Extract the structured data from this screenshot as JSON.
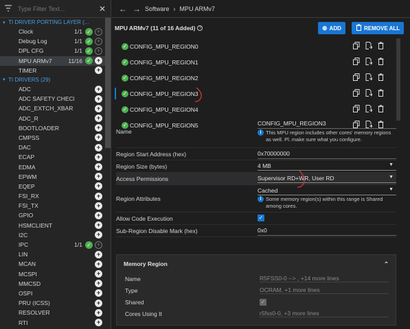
{
  "sidebar": {
    "filter_placeholder": "Type Filter Text...",
    "groups": [
      {
        "label": "TI DRIVER PORTING LAYER (...",
        "items": [
          {
            "label": "Clock",
            "count": "1/1",
            "checked": true,
            "add": "dim"
          },
          {
            "label": "Debug Log",
            "count": "1/1",
            "checked": true,
            "add": "dim"
          },
          {
            "label": "DPL CFG",
            "count": "1/1",
            "checked": true,
            "add": "dim"
          },
          {
            "label": "MPU ARMv7",
            "count": "11/16",
            "checked": true,
            "add": "solid",
            "active": true
          },
          {
            "label": "TIMER",
            "count": "",
            "checked": false,
            "add": "solid"
          }
        ]
      },
      {
        "label": "TI DRIVERS (29)",
        "items": [
          {
            "label": "ADC",
            "count": "",
            "checked": false,
            "add": "solid"
          },
          {
            "label": "ADC SAFETY CHECKER",
            "count": "",
            "checked": false,
            "add": "solid"
          },
          {
            "label": "ADC_EXTCH_XBAR",
            "count": "",
            "checked": false,
            "add": "solid"
          },
          {
            "label": "ADC_R",
            "count": "",
            "checked": false,
            "add": "solid"
          },
          {
            "label": "BOOTLOADER",
            "count": "",
            "checked": false,
            "add": "solid"
          },
          {
            "label": "CMPSS",
            "count": "",
            "checked": false,
            "add": "solid"
          },
          {
            "label": "DAC",
            "count": "",
            "checked": false,
            "add": "solid"
          },
          {
            "label": "ECAP",
            "count": "",
            "checked": false,
            "add": "solid"
          },
          {
            "label": "EDMA",
            "count": "",
            "checked": false,
            "add": "solid"
          },
          {
            "label": "EPWM",
            "count": "",
            "checked": false,
            "add": "solid"
          },
          {
            "label": "EQEP",
            "count": "",
            "checked": false,
            "add": "solid"
          },
          {
            "label": "FSI_RX",
            "count": "",
            "checked": false,
            "add": "solid"
          },
          {
            "label": "FSI_TX",
            "count": "",
            "checked": false,
            "add": "solid"
          },
          {
            "label": "GPIO",
            "count": "",
            "checked": false,
            "add": "solid"
          },
          {
            "label": "HSMCLIENT",
            "count": "",
            "checked": false,
            "add": "solid"
          },
          {
            "label": "I2C",
            "count": "",
            "checked": false,
            "add": "solid"
          },
          {
            "label": "IPC",
            "count": "1/1",
            "checked": true,
            "add": "dim"
          },
          {
            "label": "LIN",
            "count": "",
            "checked": false,
            "add": "solid"
          },
          {
            "label": "MCAN",
            "count": "",
            "checked": false,
            "add": "solid"
          },
          {
            "label": "MCSPI",
            "count": "",
            "checked": false,
            "add": "solid"
          },
          {
            "label": "MMCSD",
            "count": "",
            "checked": false,
            "add": "solid"
          },
          {
            "label": "OSPI",
            "count": "",
            "checked": false,
            "add": "solid"
          },
          {
            "label": "PRU (ICSS)",
            "count": "",
            "checked": false,
            "add": "solid"
          },
          {
            "label": "RESOLVER",
            "count": "",
            "checked": false,
            "add": "solid"
          },
          {
            "label": "RTI",
            "count": "",
            "checked": false,
            "add": "solid"
          }
        ]
      }
    ]
  },
  "breadcrumb": {
    "root": "Software",
    "current": "MPU ARMv7"
  },
  "header": {
    "title": "MPU ARMv7 (11 of 16 Added)",
    "add_label": "ADD",
    "remove_all_label": "REMOVE ALL"
  },
  "regions": [
    {
      "label": "CONFIG_MPU_REGION0"
    },
    {
      "label": "CONFIG_MPU_REGION1"
    },
    {
      "label": "CONFIG_MPU_REGION2"
    },
    {
      "label": "CONFIG_MPU_REGION3",
      "selected": true
    },
    {
      "label": "CONFIG_MPU_REGION4"
    },
    {
      "label": "CONFIG_MPU_REGION5"
    }
  ],
  "props": {
    "name_label": "Name",
    "name_value": "CONFIG_MPU_REGION3",
    "name_info": "This MPU region includes other cores' memory regions as well. Pl. make sure what you configure.",
    "start_label": "Region Start Address (hex)",
    "start_value": "0x70000000",
    "size_label": "Region Size (bytes)",
    "size_value": "4 MB",
    "access_label": "Access Permissions",
    "access_value": "Supervisor RD+WR, User RD",
    "attr_label": "Region Attributes",
    "attr_value": "Cached",
    "attr_info": "Some memory region(s) within this range is Shared among cores.",
    "exec_label": "Allow Code Execution",
    "subregion_label": "Sub-Region Disable Mark (hex)",
    "subregion_value": "0x0"
  },
  "memory": {
    "title": "Memory Region",
    "name_label": "Name",
    "name_value": "R5FSS0-0 --> , +14 more lines",
    "type_label": "Type",
    "type_value": "OCRAM, +1 more lines",
    "shared_label": "Shared",
    "cores_label": "Cores Using It",
    "cores_value": "r5fss0-0, +3 more lines"
  },
  "colors": {
    "accent": "#1976d2",
    "success": "#4caf50",
    "annotation": "#e53935"
  }
}
